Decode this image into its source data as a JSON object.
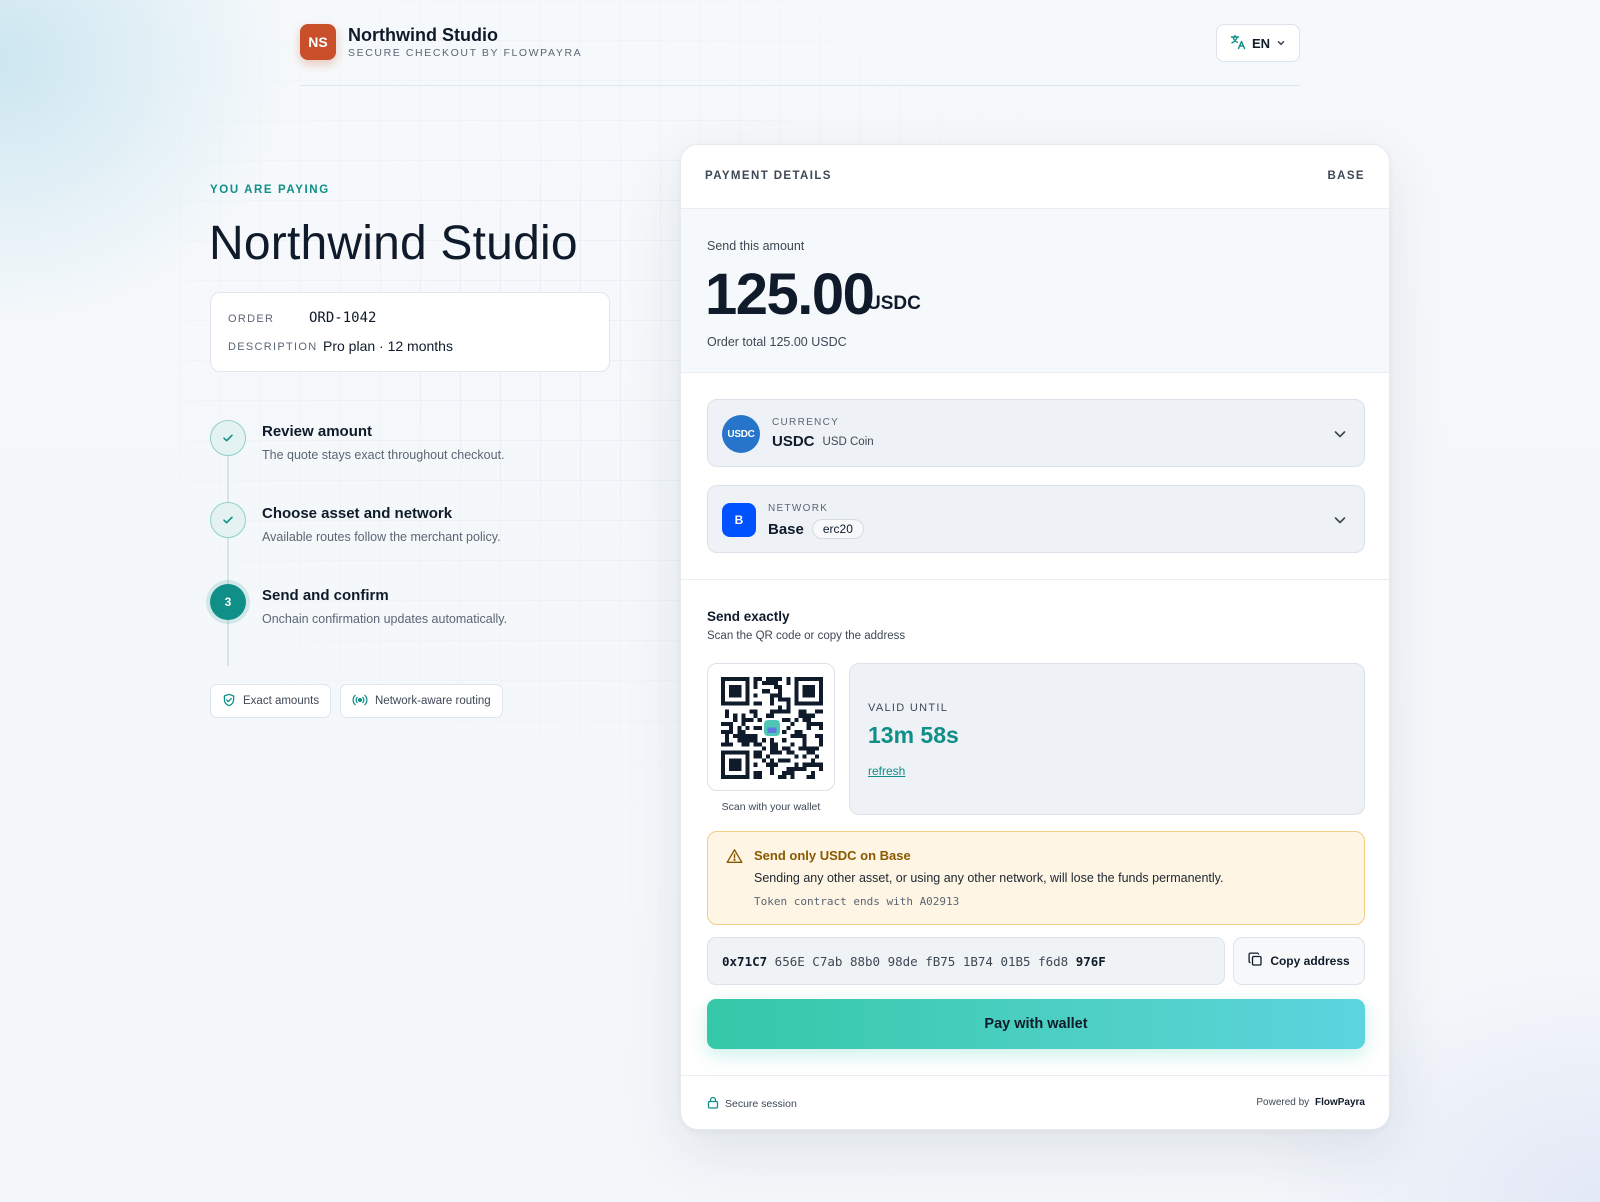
{
  "header": {
    "logo_initials": "NS",
    "merchant_name": "Northwind Studio",
    "subtitle": "SECURE CHECKOUT BY FLOWPAYRA",
    "language": "EN"
  },
  "summary": {
    "eyebrow": "YOU ARE PAYING",
    "merchant_title": "Northwind Studio",
    "order_label": "ORDER",
    "order_value": "ORD-1042",
    "description_label": "DESCRIPTION",
    "description_value": "Pro plan · 12 months"
  },
  "steps": [
    {
      "title": "Review amount",
      "desc": "The quote stays exact throughout checkout.",
      "state": "done"
    },
    {
      "title": "Choose asset and network",
      "desc": "Available routes follow the merchant policy.",
      "state": "done"
    },
    {
      "title": "Send and confirm",
      "desc": "Onchain confirmation updates automatically.",
      "state": "active",
      "number": "3"
    }
  ],
  "chips": [
    {
      "label": "Exact amounts",
      "icon": "shield-check-icon"
    },
    {
      "label": "Network-aware routing",
      "icon": "broadcast-icon"
    }
  ],
  "payment": {
    "header_left": "PAYMENT DETAILS",
    "header_right": "BASE",
    "send_label": "Send this amount",
    "amount": "125.00",
    "currency": "USDC",
    "order_total": "Order total 125.00 USDC",
    "currency_selector": {
      "label": "CURRENCY",
      "value": "USDC",
      "sub": "USD Coin",
      "icon_text": "USDC"
    },
    "network_selector": {
      "label": "NETWORK",
      "value": "Base",
      "tag": "erc20",
      "icon_text": "B"
    },
    "send_exactly_title": "Send exactly",
    "send_exactly_sub": "Scan the QR code or copy the address",
    "qr_caption": "Scan with your wallet",
    "valid_label": "VALID UNTIL",
    "valid_time": "13m 58s",
    "refresh_label": "refresh",
    "warning": {
      "title": "Send only USDC on Base",
      "body": "Sending any other asset, or using any other network, will lose the funds permanently.",
      "contract": "Token contract ends with A02913"
    },
    "address": {
      "start": "0x71C7",
      "middle": " 656E C7ab 88b0 98de fB75 1B74 01B5 f6d8 ",
      "end": "976F"
    },
    "copy_label": "Copy address",
    "pay_label": "Pay with wallet",
    "footer_left": "Secure session",
    "footer_powered": "Powered by",
    "footer_brand": "FlowPayra"
  },
  "colors": {
    "accent": "#0f8f87",
    "brand_logo": "#c84f2a",
    "usdc_blue": "#2775ca",
    "base_blue": "#0052ff",
    "warning_bg": "#fef5e4",
    "warning_text": "#8a5a00"
  }
}
